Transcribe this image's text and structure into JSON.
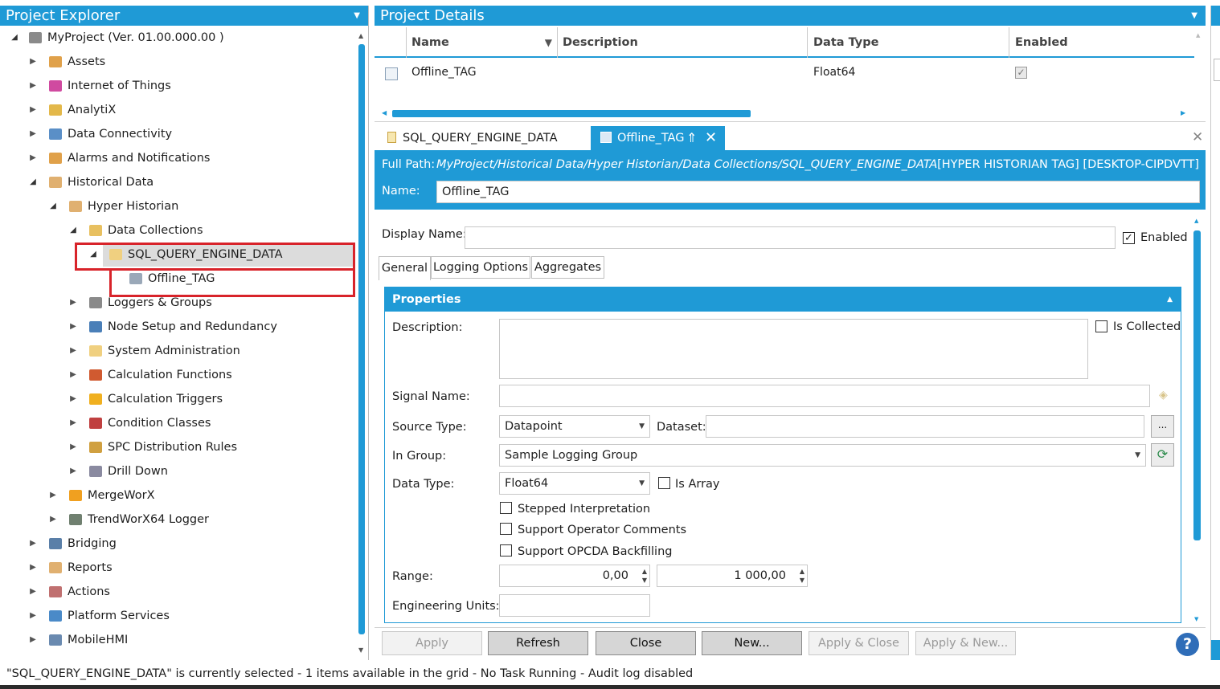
{
  "explorer": {
    "title": "Project Explorer",
    "tree": [
      {
        "label": "MyProject (Ver. 01.00.000.00 )",
        "icon": "project-icon",
        "color": "#8a8a8a"
      },
      {
        "label": "Assets",
        "icon": "assets-icon",
        "color": "#e0a14a"
      },
      {
        "label": "Internet of Things",
        "icon": "iot-icon",
        "color": "#d04aa0"
      },
      {
        "label": "AnalytiX",
        "icon": "analytix-icon",
        "color": "#e3b84a"
      },
      {
        "label": "Data Connectivity",
        "icon": "data-connectivity-icon",
        "color": "#5a8fc7"
      },
      {
        "label": "Alarms and Notifications",
        "icon": "alarm-icon",
        "color": "#e0a14a"
      },
      {
        "label": "Historical Data",
        "icon": "historical-data-icon",
        "color": "#e0b070"
      },
      {
        "label": "Hyper Historian",
        "icon": "hyper-historian-icon",
        "color": "#e0b070"
      },
      {
        "label": "Data Collections",
        "icon": "data-collections-icon",
        "color": "#e8c060"
      },
      {
        "label": "SQL_QUERY_ENGINE_DATA",
        "icon": "folder-icon",
        "color": "#f0d080"
      },
      {
        "label": "Offline_TAG",
        "icon": "tag-icon",
        "color": "#9aa8b8"
      },
      {
        "label": "Loggers & Groups",
        "icon": "loggers-icon",
        "color": "#8a8a8a"
      },
      {
        "label": "Node Setup and Redundancy",
        "icon": "node-setup-icon",
        "color": "#4a7fb8"
      },
      {
        "label": "System Administration",
        "icon": "system-admin-icon",
        "color": "#f0d080"
      },
      {
        "label": "Calculation Functions",
        "icon": "calc-functions-icon",
        "color": "#d05a30"
      },
      {
        "label": "Calculation Triggers",
        "icon": "calc-triggers-icon",
        "color": "#f0b020"
      },
      {
        "label": "Condition Classes",
        "icon": "condition-classes-icon",
        "color": "#c04040"
      },
      {
        "label": "SPC Distribution Rules",
        "icon": "spc-icon",
        "color": "#d0a040"
      },
      {
        "label": "Drill Down",
        "icon": "drill-down-icon",
        "color": "#8a8aa0"
      },
      {
        "label": "MergeWorX",
        "icon": "mergeworx-icon",
        "color": "#f0a020"
      },
      {
        "label": "TrendWorX64 Logger",
        "icon": "trendworx-icon",
        "color": "#708070"
      },
      {
        "label": "Bridging",
        "icon": "bridging-icon",
        "color": "#5a7fa8"
      },
      {
        "label": "Reports",
        "icon": "reports-icon",
        "color": "#e0b070"
      },
      {
        "label": "Actions",
        "icon": "actions-icon",
        "color": "#c07070"
      },
      {
        "label": "Platform Services",
        "icon": "platform-icon",
        "color": "#4a8ac8"
      },
      {
        "label": "MobileHMI",
        "icon": "mobilehmi-icon",
        "color": "#6a8ab0"
      }
    ]
  },
  "details": {
    "title": "Project Details",
    "grid": {
      "columns": [
        "Name",
        "Description",
        "Data Type",
        "Enabled"
      ],
      "rows": [
        {
          "name": "Offline_TAG",
          "description": "",
          "data_type": "Float64",
          "enabled": true
        }
      ]
    },
    "tabs": [
      "SQL_QUERY_ENGINE_DATA",
      "Offline_TAG"
    ],
    "full_path_label": "Full Path:",
    "full_path": "MyProject/Historical Data/Hyper Historian/Data Collections/SQL_QUERY_ENGINE_DATA",
    "type_tag": "[HYPER HISTORIAN TAG] [DESKTOP-CIPDVTT]",
    "name_label": "Name:",
    "name_value": "Offline_TAG",
    "display_name_label": "Display Name:",
    "display_name_value": "",
    "enabled_label": "Enabled",
    "subtabs": [
      "General",
      "Logging Options",
      "Aggregates"
    ],
    "properties_title": "Properties",
    "description_label": "Description:",
    "is_collected_label": "Is Collected",
    "signal_name_label": "Signal Name:",
    "source_type_label": "Source Type:",
    "source_type_value": "Datapoint",
    "dataset_label": "Dataset:",
    "dataset_btn": "...",
    "in_group_label": "In Group:",
    "in_group_value": "Sample Logging Group",
    "data_type_label": "Data Type:",
    "data_type_value": "Float64",
    "is_array_label": "Is Array",
    "stepped_label": "Stepped Interpretation",
    "operator_comments_label": "Support Operator Comments",
    "opcda_label": "Support OPCDA Backfilling",
    "range_label": "Range:",
    "range_low": "0,00",
    "range_high": "1 000,00",
    "eng_units_label": "Engineering Units:",
    "buttons": {
      "apply": "Apply",
      "refresh": "Refresh",
      "close": "Close",
      "new": "New...",
      "apply_close": "Apply & Close",
      "apply_new": "Apply & New..."
    },
    "help": "?"
  },
  "status": "\"SQL_QUERY_ENGINE_DATA\" is currently selected - 1 items available in the grid - No Task Running - Audit log disabled",
  "colors": {
    "accent": "#1f9ad6",
    "highlight_box": "#d8232a"
  }
}
